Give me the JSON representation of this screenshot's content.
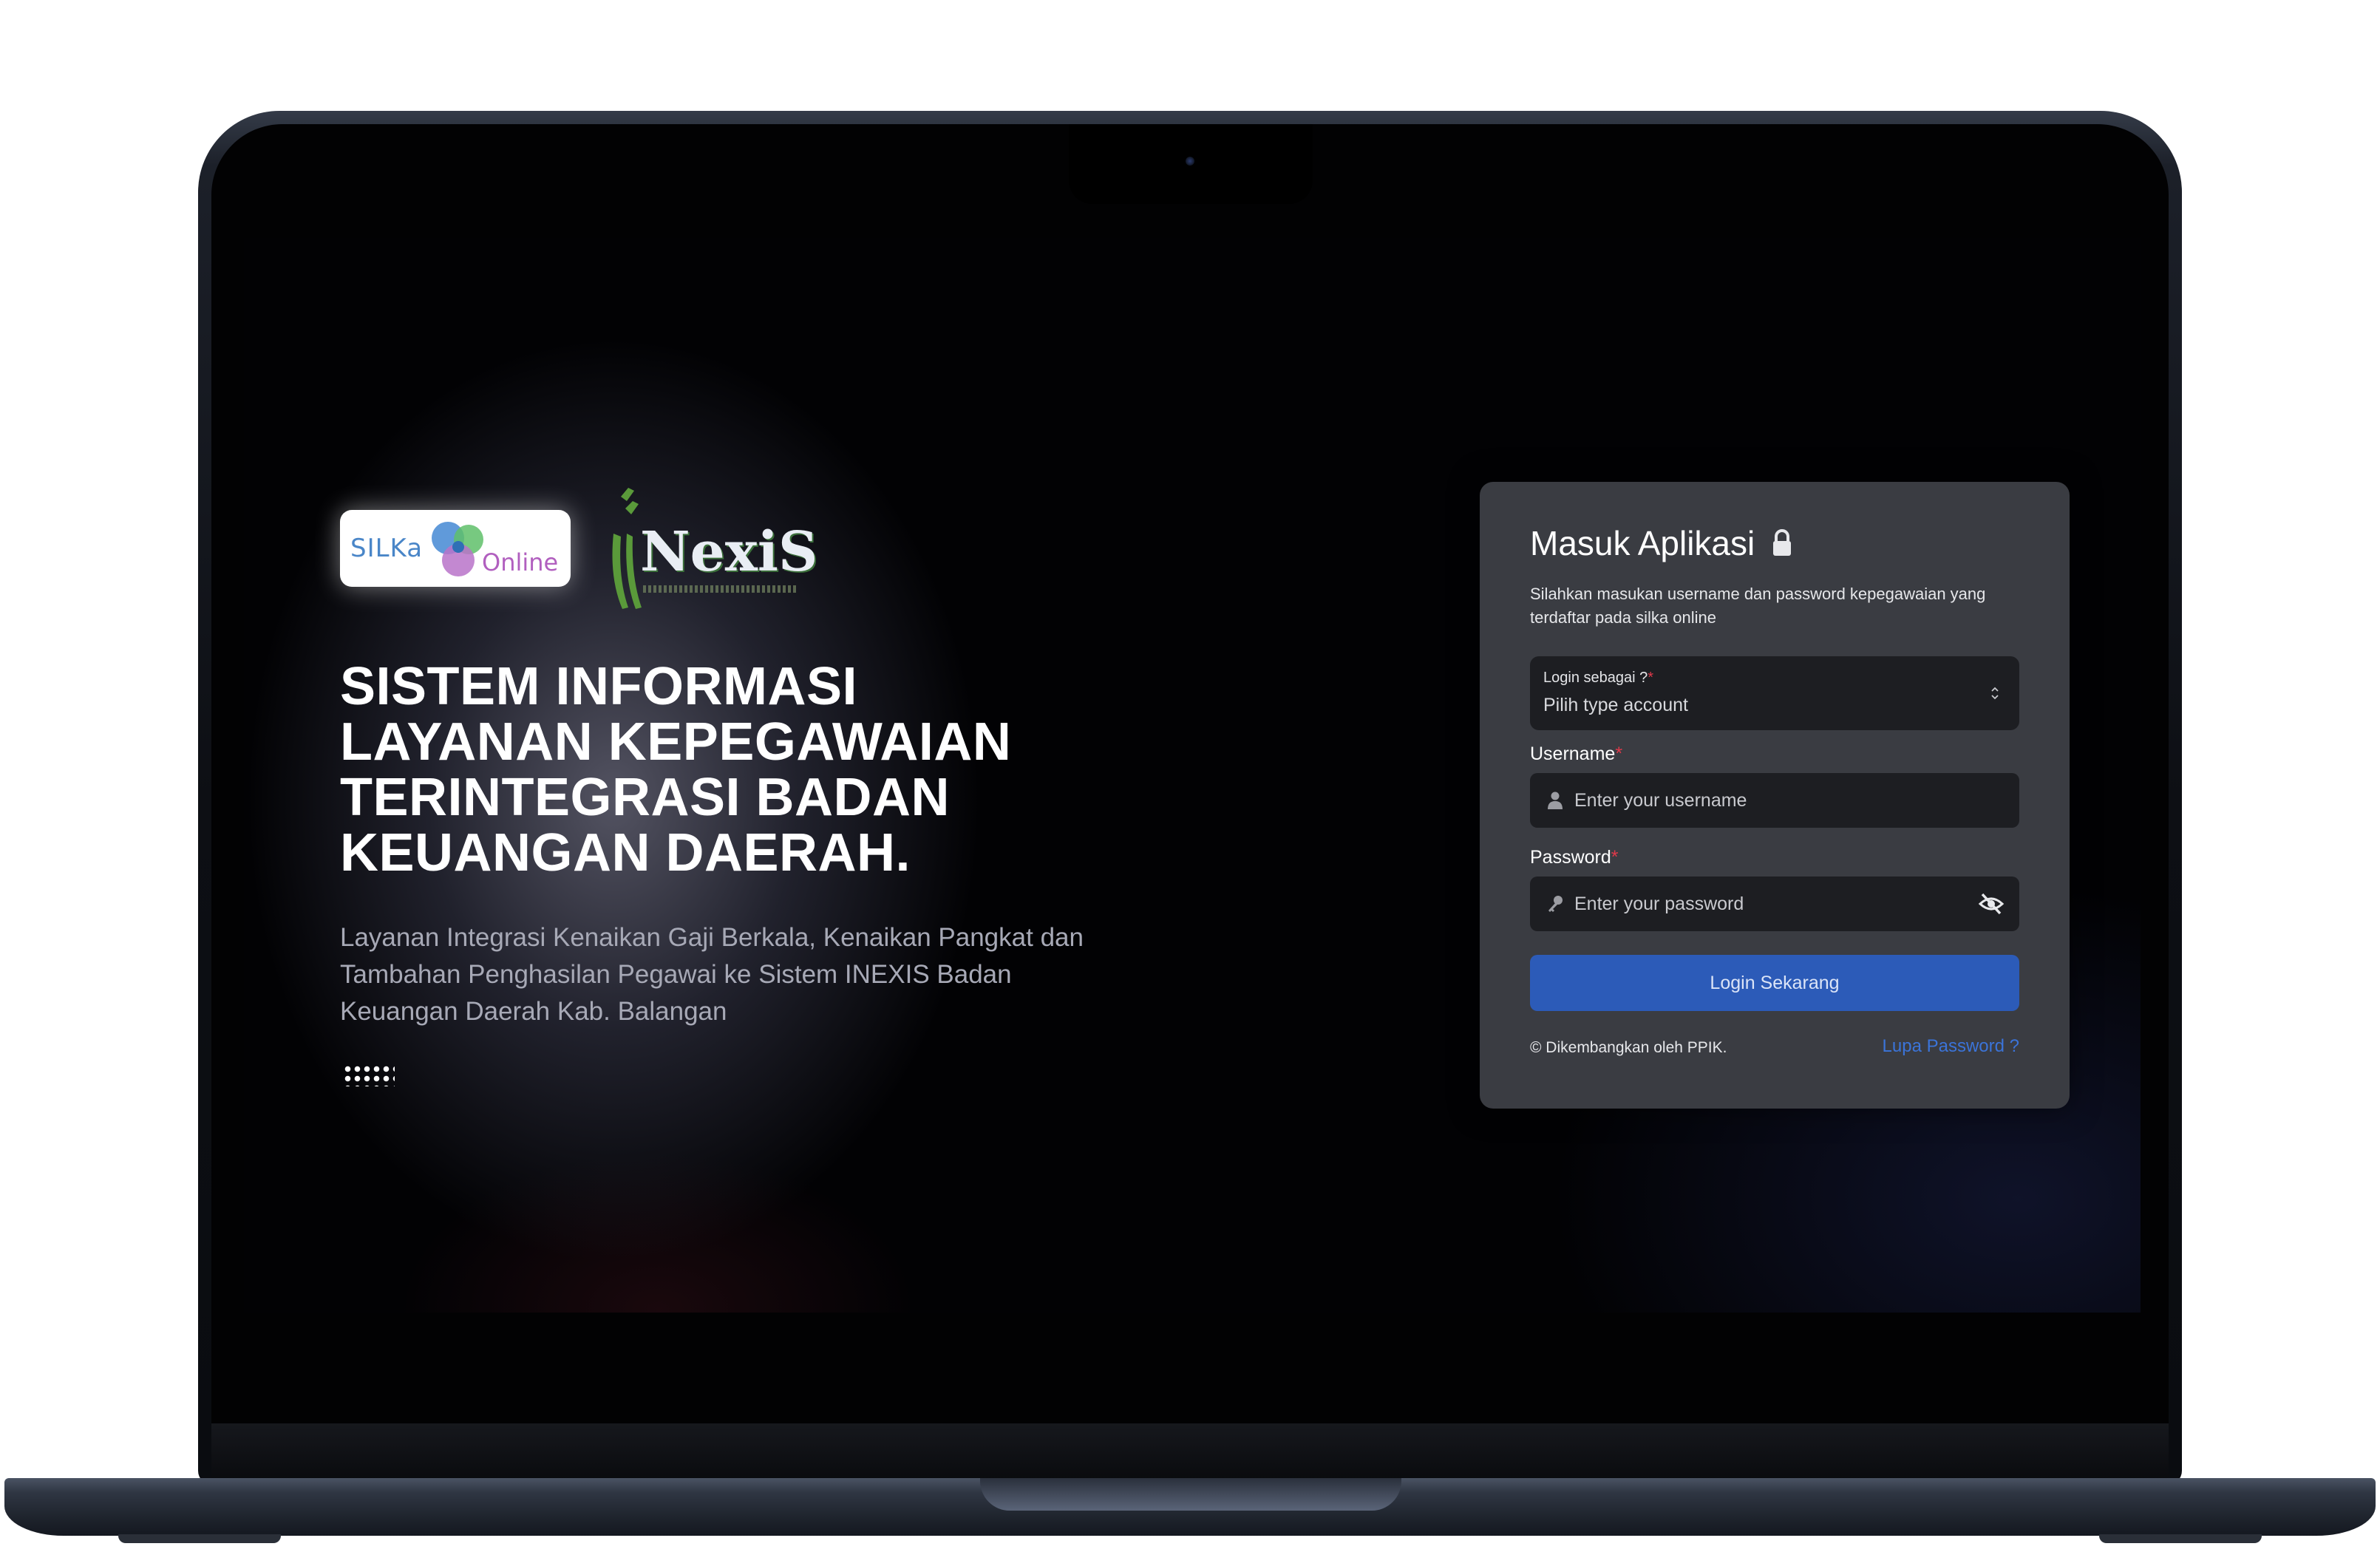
{
  "hero": {
    "logo_silka_left": "SILKa",
    "logo_silka_right": "Online",
    "logo_inexis": "NexiS",
    "title_lines": [
      "SISTEM INFORMASI",
      "LAYANAN KEPEGAWAIAN",
      "TERINTEGRASI BADAN",
      "KEUANGAN DAERAH."
    ],
    "description": "Layanan Integrasi Kenaikan Gaji Berkala, Kenaikan Pangkat dan Tambahan Penghasilan Pegawai ke Sistem INEXIS Badan Keuangan Daerah Kab. Balangan"
  },
  "login": {
    "title": "Masuk Aplikasi",
    "description": "Silahkan masukan username dan password kepegawaian yang terdaftar pada silka online",
    "account_type": {
      "label": "Login sebagai ?",
      "required_mark": "*",
      "value": "Pilih type account"
    },
    "username": {
      "label": "Username",
      "required_mark": "*",
      "placeholder": "Enter your username"
    },
    "password": {
      "label": "Password",
      "required_mark": "*",
      "placeholder": "Enter your password"
    },
    "submit_label": "Login Sekarang",
    "footer_credit": "© Dikembangkan oleh PPIK.",
    "forgot_password": "Lupa Password ?"
  },
  "icons": {
    "lock": "lock-icon",
    "user": "user-icon",
    "key": "key-icon",
    "eye_off": "eye-off-icon",
    "chevron": "chevron-updown-icon"
  },
  "colors": {
    "card_bg": "#3a3c42",
    "input_bg": "#1d1e22",
    "primary": "#2c5bb8",
    "link": "#3b74d9",
    "required": "#e0394a"
  }
}
